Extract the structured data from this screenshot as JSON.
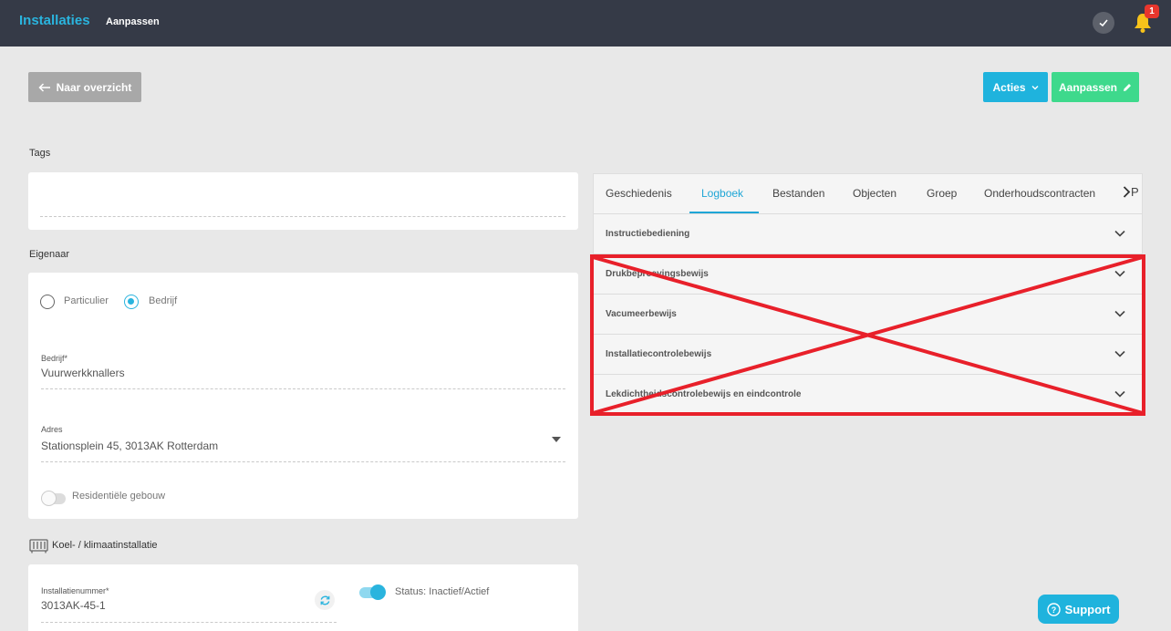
{
  "header": {
    "brand": "Installaties",
    "breadcrumb": "Aanpassen",
    "notification_count": "1"
  },
  "toolbar": {
    "back_label": "Naar overzicht",
    "actions_label": "Acties",
    "edit_label": "Aanpassen"
  },
  "tags": {
    "section_label": "Tags"
  },
  "owner": {
    "section_label": "Eigenaar",
    "radio_private": "Particulier",
    "radio_company": "Bedrijf",
    "selected": "Bedrijf",
    "company_label": "Bedrijf*",
    "company_value": "Vuurwerkknallers",
    "address_label": "Adres",
    "address_value": "Stationsplein 45, 3013AK Rotterdam",
    "residential_label": "Residentiële gebouw",
    "residential_on": false
  },
  "installation": {
    "section_label": "Koel- / klimaatinstallatie",
    "number_label": "Installatienummer*",
    "number_value": "3013AK-45-1",
    "status_label": "Status: Inactief/Actief",
    "status_on": true
  },
  "tabs": {
    "items": [
      "Geschiedenis",
      "Logboek",
      "Bestanden",
      "Objecten",
      "Groep",
      "Onderhoudscontracten"
    ],
    "active": "Logboek",
    "overflow_label": "P"
  },
  "accordion": {
    "items": [
      "Instructiebediening",
      "Drukbeproevingsbewijs",
      "Vacumeerbewijs",
      "Installatiecontrolebewijs",
      "Lekdichtheidscontrolebewijs en eindcontrole"
    ]
  },
  "support": {
    "label": "Support"
  },
  "colors": {
    "topbar": "#353a47",
    "accent": "#1fb3dd",
    "success": "#3ed98c",
    "annotation_red": "#e8202a"
  }
}
